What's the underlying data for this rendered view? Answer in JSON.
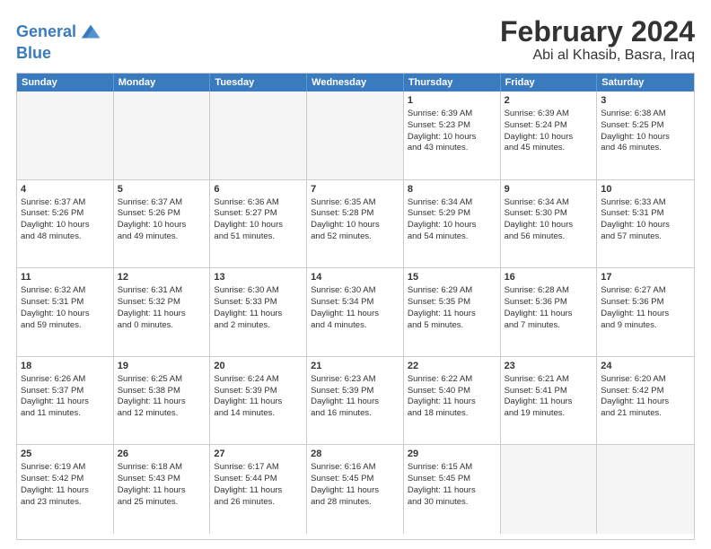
{
  "logo": {
    "line1": "General",
    "line2": "Blue"
  },
  "title": "February 2024",
  "subtitle": "Abi al Khasib, Basra, Iraq",
  "headers": [
    "Sunday",
    "Monday",
    "Tuesday",
    "Wednesday",
    "Thursday",
    "Friday",
    "Saturday"
  ],
  "weeks": [
    [
      {
        "day": "",
        "info": ""
      },
      {
        "day": "",
        "info": ""
      },
      {
        "day": "",
        "info": ""
      },
      {
        "day": "",
        "info": ""
      },
      {
        "day": "1",
        "info": "Sunrise: 6:39 AM\nSunset: 5:23 PM\nDaylight: 10 hours\nand 43 minutes."
      },
      {
        "day": "2",
        "info": "Sunrise: 6:39 AM\nSunset: 5:24 PM\nDaylight: 10 hours\nand 45 minutes."
      },
      {
        "day": "3",
        "info": "Sunrise: 6:38 AM\nSunset: 5:25 PM\nDaylight: 10 hours\nand 46 minutes."
      }
    ],
    [
      {
        "day": "4",
        "info": "Sunrise: 6:37 AM\nSunset: 5:26 PM\nDaylight: 10 hours\nand 48 minutes."
      },
      {
        "day": "5",
        "info": "Sunrise: 6:37 AM\nSunset: 5:26 PM\nDaylight: 10 hours\nand 49 minutes."
      },
      {
        "day": "6",
        "info": "Sunrise: 6:36 AM\nSunset: 5:27 PM\nDaylight: 10 hours\nand 51 minutes."
      },
      {
        "day": "7",
        "info": "Sunrise: 6:35 AM\nSunset: 5:28 PM\nDaylight: 10 hours\nand 52 minutes."
      },
      {
        "day": "8",
        "info": "Sunrise: 6:34 AM\nSunset: 5:29 PM\nDaylight: 10 hours\nand 54 minutes."
      },
      {
        "day": "9",
        "info": "Sunrise: 6:34 AM\nSunset: 5:30 PM\nDaylight: 10 hours\nand 56 minutes."
      },
      {
        "day": "10",
        "info": "Sunrise: 6:33 AM\nSunset: 5:31 PM\nDaylight: 10 hours\nand 57 minutes."
      }
    ],
    [
      {
        "day": "11",
        "info": "Sunrise: 6:32 AM\nSunset: 5:31 PM\nDaylight: 10 hours\nand 59 minutes."
      },
      {
        "day": "12",
        "info": "Sunrise: 6:31 AM\nSunset: 5:32 PM\nDaylight: 11 hours\nand 0 minutes."
      },
      {
        "day": "13",
        "info": "Sunrise: 6:30 AM\nSunset: 5:33 PM\nDaylight: 11 hours\nand 2 minutes."
      },
      {
        "day": "14",
        "info": "Sunrise: 6:30 AM\nSunset: 5:34 PM\nDaylight: 11 hours\nand 4 minutes."
      },
      {
        "day": "15",
        "info": "Sunrise: 6:29 AM\nSunset: 5:35 PM\nDaylight: 11 hours\nand 5 minutes."
      },
      {
        "day": "16",
        "info": "Sunrise: 6:28 AM\nSunset: 5:36 PM\nDaylight: 11 hours\nand 7 minutes."
      },
      {
        "day": "17",
        "info": "Sunrise: 6:27 AM\nSunset: 5:36 PM\nDaylight: 11 hours\nand 9 minutes."
      }
    ],
    [
      {
        "day": "18",
        "info": "Sunrise: 6:26 AM\nSunset: 5:37 PM\nDaylight: 11 hours\nand 11 minutes."
      },
      {
        "day": "19",
        "info": "Sunrise: 6:25 AM\nSunset: 5:38 PM\nDaylight: 11 hours\nand 12 minutes."
      },
      {
        "day": "20",
        "info": "Sunrise: 6:24 AM\nSunset: 5:39 PM\nDaylight: 11 hours\nand 14 minutes."
      },
      {
        "day": "21",
        "info": "Sunrise: 6:23 AM\nSunset: 5:39 PM\nDaylight: 11 hours\nand 16 minutes."
      },
      {
        "day": "22",
        "info": "Sunrise: 6:22 AM\nSunset: 5:40 PM\nDaylight: 11 hours\nand 18 minutes."
      },
      {
        "day": "23",
        "info": "Sunrise: 6:21 AM\nSunset: 5:41 PM\nDaylight: 11 hours\nand 19 minutes."
      },
      {
        "day": "24",
        "info": "Sunrise: 6:20 AM\nSunset: 5:42 PM\nDaylight: 11 hours\nand 21 minutes."
      }
    ],
    [
      {
        "day": "25",
        "info": "Sunrise: 6:19 AM\nSunset: 5:42 PM\nDaylight: 11 hours\nand 23 minutes."
      },
      {
        "day": "26",
        "info": "Sunrise: 6:18 AM\nSunset: 5:43 PM\nDaylight: 11 hours\nand 25 minutes."
      },
      {
        "day": "27",
        "info": "Sunrise: 6:17 AM\nSunset: 5:44 PM\nDaylight: 11 hours\nand 26 minutes."
      },
      {
        "day": "28",
        "info": "Sunrise: 6:16 AM\nSunset: 5:45 PM\nDaylight: 11 hours\nand 28 minutes."
      },
      {
        "day": "29",
        "info": "Sunrise: 6:15 AM\nSunset: 5:45 PM\nDaylight: 11 hours\nand 30 minutes."
      },
      {
        "day": "",
        "info": ""
      },
      {
        "day": "",
        "info": ""
      }
    ]
  ]
}
